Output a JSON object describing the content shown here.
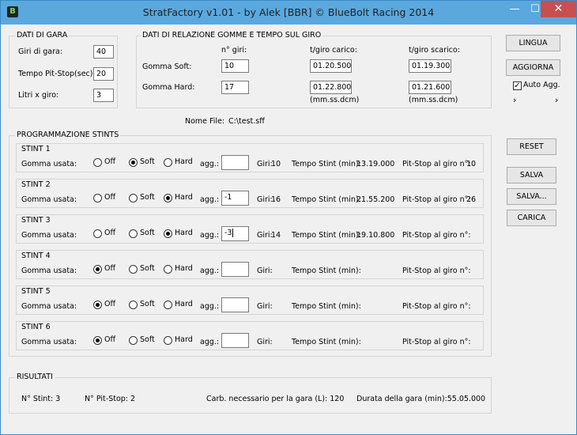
{
  "window": {
    "icon_text": "B",
    "title": "StratFactory v1.01   -   by Alek [BBR]  © BlueBolt Racing 2014",
    "minimize": "—",
    "maximize": "☐",
    "close": "✕"
  },
  "dati_gara": {
    "title": "DATI DI GARA",
    "giri_label": "Giri di gara:",
    "giri_value": "40",
    "pit_label": "Tempo Pit-Stop(sec):",
    "pit_value": "20",
    "litri_label": "Litri x giro:",
    "litri_value": "3"
  },
  "relazione": {
    "title": "DATI DI RELAZIONE GOMME E TEMPO SUL GIRO",
    "col_giri": "n° giri:",
    "col_carico": "t/giro carico:",
    "col_scarico": "t/giro scarico:",
    "soft_label": "Gomma Soft:",
    "soft_giri": "10",
    "soft_carico": "01.20.500",
    "soft_scarico": "01.19.300",
    "hard_label": "Gomma Hard:",
    "hard_giri": "17",
    "hard_carico": "01.22.800",
    "hard_scarico": "01.21.600",
    "format_carico": "(mm.ss.dcm)",
    "format_scarico": "(mm.ss.dcm)"
  },
  "file": {
    "label": "Nome File:",
    "value": "C:\\test.sff"
  },
  "stints_title": "PROGRAMMAZIONE STINTS",
  "stint_labels": {
    "gomma": "Gomma usata:",
    "off": "Off",
    "soft": "Soft",
    "hard": "Hard",
    "agg": "agg.:",
    "giri": "Giri:",
    "tempo": "Tempo Stint (min):",
    "pitstop": "Pit-Stop al giro n°:"
  },
  "stints": [
    {
      "title": "STINT 1",
      "selected": "soft",
      "agg": "",
      "giri": "10",
      "tempo": "13.19.000",
      "pitstop": "10"
    },
    {
      "title": "STINT 2",
      "selected": "hard",
      "agg": "-1",
      "giri": "16",
      "tempo": "21.55.200",
      "pitstop": "26"
    },
    {
      "title": "STINT 3",
      "selected": "hard",
      "agg": "-3",
      "giri": "14",
      "tempo": "19.10.800",
      "pitstop": ""
    },
    {
      "title": "STINT 4",
      "selected": "off",
      "agg": "",
      "giri": "",
      "tempo": "",
      "pitstop": ""
    },
    {
      "title": "STINT 5",
      "selected": "off",
      "agg": "",
      "giri": "",
      "tempo": "",
      "pitstop": ""
    },
    {
      "title": "STINT 6",
      "selected": "off",
      "agg": "",
      "giri": "",
      "tempo": "",
      "pitstop": ""
    }
  ],
  "risultati": {
    "title": "RISULTATI",
    "n_stint": "N° Stint: 3",
    "n_pitstop": "N° Pit-Stop:  2",
    "carb": "Carb. necessario per la gara (L):  120",
    "durata": "Durata della gara (min):55.05.000"
  },
  "buttons": {
    "lingua": "LINGUA",
    "aggiorna": "AGGIORNA",
    "auto_agg": "Auto Agg.",
    "auto_checked": "✓",
    "arrow_left": "›",
    "arrow_right": "›",
    "reset": "RESET",
    "salva": "SALVA",
    "salva_as": "SALVA...",
    "carica": "CARICA"
  }
}
